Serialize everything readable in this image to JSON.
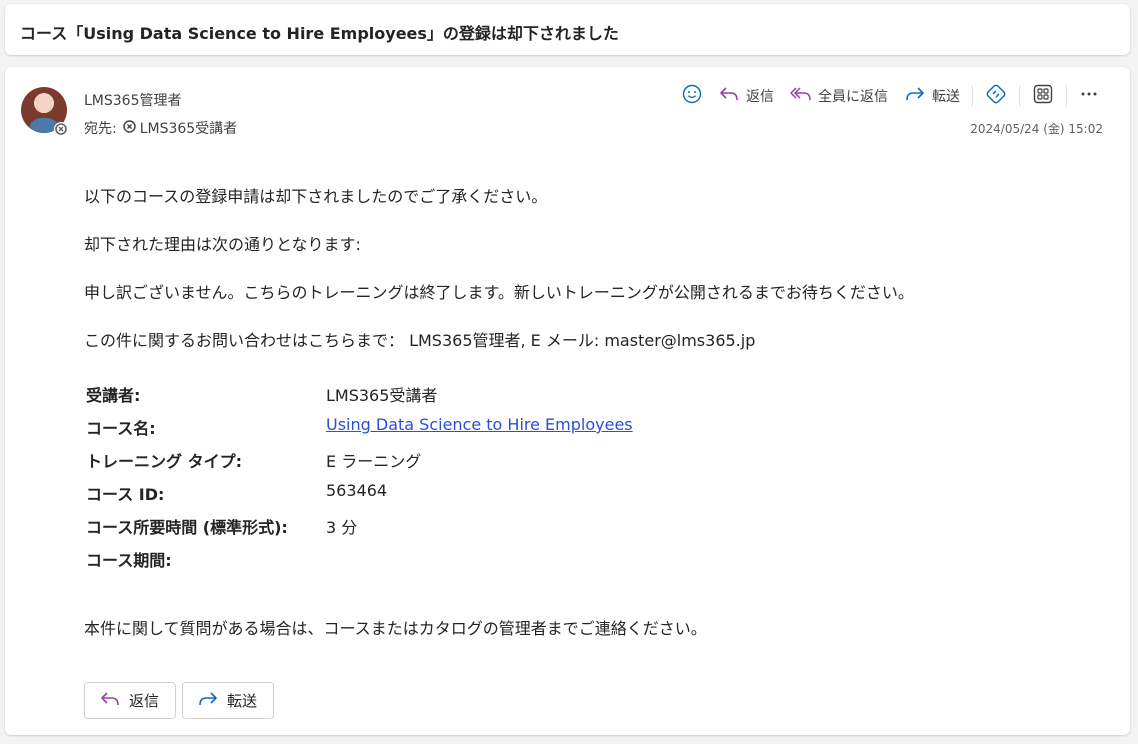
{
  "subject": "コース「Using Data Science to Hire Employees」の登録は却下されました",
  "message": {
    "sender": "LMS365管理者",
    "to_label": "宛先:",
    "to_recipient": "LMS365受講者",
    "timestamp": "2024/05/24 (金) 15:02",
    "toolbar": {
      "reply": "返信",
      "reply_all": "全員に返信",
      "forward": "転送"
    },
    "body": {
      "p1": "以下のコースの登録申請は却下されましたのでご了承ください。",
      "p2": "却下された理由は次の通りとなります:",
      "p3": "申し訳ございません。こちらのトレーニングは終了します。新しいトレーニングが公開されるまでお待ちください。",
      "p4": "この件に関するお問い合わせはこちらまで： LMS365管理者, E メール: master@lms365.jp",
      "details": [
        {
          "label": "受講者:",
          "value": "LMS365受講者"
        },
        {
          "label": "コース名:",
          "value": "Using Data Science to Hire Employees"
        },
        {
          "label": "トレーニング タイプ:",
          "value": "E ラーニング"
        },
        {
          "label": "コース ID:",
          "value": "563464"
        },
        {
          "label": "コース所要時間 (標準形式):",
          "value": "3 分"
        },
        {
          "label": "コース期間:",
          "value": ""
        }
      ],
      "closing": "本件に関して質問がある場合は、コースまたはカタログの管理者までご連絡ください。"
    },
    "footer": {
      "reply": "返信",
      "forward": "転送"
    }
  },
  "colors": {
    "accent_purple": "#9b3fa8",
    "accent_blue": "#0f6cbd",
    "link": "#2b4fd6"
  }
}
